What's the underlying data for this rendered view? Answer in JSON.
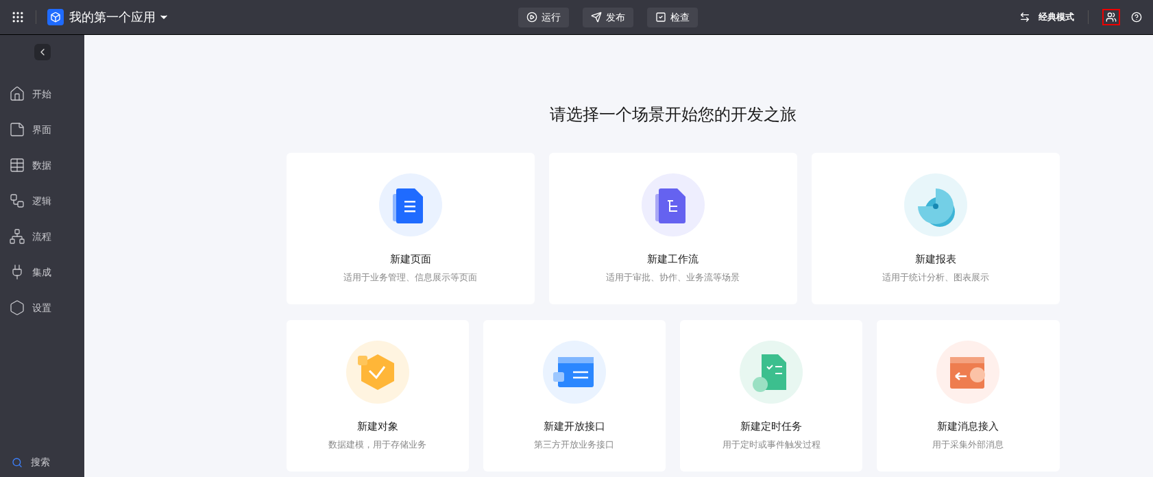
{
  "app": {
    "title": "我的第一个应用"
  },
  "toolbar": [
    {
      "kind": "run",
      "label": "运行"
    },
    {
      "kind": "publish",
      "label": "发布"
    },
    {
      "kind": "check",
      "label": "检查"
    }
  ],
  "mode_switch": {
    "label": "经典模式"
  },
  "user_button": {
    "highlighted": true
  },
  "sidebar": {
    "items": [
      {
        "kind": "home",
        "label": "开始"
      },
      {
        "kind": "page",
        "label": "界面"
      },
      {
        "kind": "table",
        "label": "数据"
      },
      {
        "kind": "logic",
        "label": "逻辑"
      },
      {
        "kind": "flow",
        "label": "流程"
      },
      {
        "kind": "plug",
        "label": "集成"
      },
      {
        "kind": "settings",
        "label": "设置"
      }
    ],
    "search": "搜索"
  },
  "heading": "请选择一个场景开始您的开发之旅",
  "cards_row_1": [
    {
      "kind": "page",
      "title": "新建页面",
      "description": "适用于业务管理、信息展示等页面"
    },
    {
      "kind": "workflow",
      "title": "新建工作流",
      "description": "适用于审批、协作、业务流等场景"
    },
    {
      "kind": "report",
      "title": "新建报表",
      "description": "适用于统计分析、图表展示"
    }
  ],
  "cards_row_2": [
    {
      "kind": "object",
      "title": "新建对象",
      "description": "数据建模，用于存储业务"
    },
    {
      "kind": "api",
      "title": "新建开放接口",
      "description": "第三方开放业务接口"
    },
    {
      "kind": "timer",
      "title": "新建定时任务",
      "description": "用于定时或事件触发过程"
    },
    {
      "kind": "message",
      "title": "新建消息接入",
      "description": "用于采集外部消息"
    }
  ]
}
